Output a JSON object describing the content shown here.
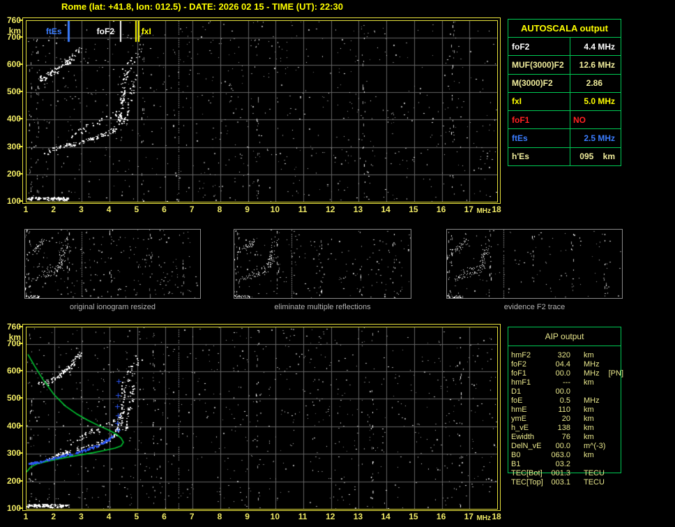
{
  "title": "Rome (lat: +41.8, lon: 012.5) - DATE: 2026 02 15 - TIME (UT): 22:30",
  "colors": {
    "background": "#000000",
    "frame_yellow": "#e8e23c",
    "tick_yellow": "#f0ea66",
    "title_yellow": "#ffff00",
    "grid_gray": "#666666",
    "table_green": "#00cc55",
    "white": "#ffffff",
    "khaki": "#f0ec9c",
    "yellow": "#ffff00",
    "red": "#ff2222",
    "blue": "#3b7dff",
    "aip_text": "#e9e78c",
    "caption_gray": "#b4b4b4",
    "profile_green": "#00c832",
    "trace_blue": "#2b55f0"
  },
  "autoscala_table": {
    "header": "AUTOSCALA output",
    "rows": [
      {
        "label": "foF2",
        "value": "4.4 MHz",
        "color": "white"
      },
      {
        "label": "MUF(3000)F2",
        "value": "12.6 MHz",
        "color": "khaki"
      },
      {
        "label": "M(3000)F2",
        "value": "2.86",
        "color": "khaki"
      },
      {
        "label": "fxI",
        "value": "5.0 MHz",
        "color": "yellow"
      },
      {
        "label": "foF1",
        "value": "NO",
        "color": "red"
      },
      {
        "label": "ftEs",
        "value": "2.5 MHz",
        "color": "blue"
      },
      {
        "label": "h'Es",
        "value": "095    km",
        "color": "khaki"
      }
    ]
  },
  "aip_table": {
    "header": "AIP output",
    "rows": [
      {
        "label": "hmF2",
        "value": "320",
        "unit": "km",
        "extra": ""
      },
      {
        "label": "foF2",
        "value": "04.4",
        "unit": "MHz",
        "extra": ""
      },
      {
        "label": "foF1",
        "value": "00.0",
        "unit": "MHz",
        "extra": "[PN]"
      },
      {
        "label": "hmF1",
        "value": "---",
        "unit": "km",
        "extra": ""
      },
      {
        "label": "D1",
        "value": "00.0",
        "unit": "",
        "extra": ""
      },
      {
        "label": "foE",
        "value": "0.5",
        "unit": "MHz",
        "extra": ""
      },
      {
        "label": "hmE",
        "value": "110",
        "unit": "km",
        "extra": ""
      },
      {
        "label": "ymE",
        "value": "20",
        "unit": "km",
        "extra": ""
      },
      {
        "label": "h_vE",
        "value": "138",
        "unit": "km",
        "extra": ""
      },
      {
        "label": "Ewidth",
        "value": "76",
        "unit": "km",
        "extra": ""
      },
      {
        "label": "DelN_vE",
        "value": "00.0",
        "unit": "m^(-3)",
        "extra": ""
      },
      {
        "label": "B0",
        "value": "063.0",
        "unit": "km",
        "extra": ""
      },
      {
        "label": "B1",
        "value": "03.2",
        "unit": "",
        "extra": ""
      },
      {
        "label": "TEC[Bot]",
        "value": "001.3",
        "unit": "TECU",
        "extra": ""
      },
      {
        "label": "TEC[Top]",
        "value": "003.1",
        "unit": "TECU",
        "extra": ""
      }
    ]
  },
  "thumbnails": [
    {
      "caption": "original ionogram resized",
      "noise_dots": 420
    },
    {
      "caption": "eliminate multiple reflections",
      "noise_dots": 330
    },
    {
      "caption": "evidence F2 trace",
      "noise_dots": 190
    }
  ],
  "chart_data": [
    {
      "type": "scatter",
      "name": "autoscaled ionogram",
      "xlabel": "MHz",
      "ylabel": "km",
      "xlim": [
        1,
        18
      ],
      "ylim": [
        100,
        760
      ],
      "x_ticks": [
        1,
        2,
        3,
        4,
        5,
        6,
        7,
        8,
        9,
        10,
        11,
        12,
        13,
        14,
        15,
        16,
        17,
        18
      ],
      "y_ticks": [
        760,
        700,
        600,
        500,
        400,
        300,
        200,
        100
      ],
      "grid": true,
      "markers": [
        {
          "label": "ftEs",
          "freq": 2.5,
          "color": "#3b7dff",
          "style": "line",
          "w": 3,
          "side": "left"
        },
        {
          "label": "foF2",
          "freq": 4.4,
          "color": "#ffffff",
          "style": "line",
          "w": 2,
          "side": "left"
        },
        {
          "label": "fxI",
          "freq": 5.0,
          "color": "#ffff00",
          "style": "double-line",
          "w": 2,
          "side": "right"
        }
      ],
      "traces": [
        {
          "name": "Es layer",
          "color": "#ffffff",
          "size": 2,
          "n": 100,
          "jitter": [
            2,
            2
          ],
          "points": [
            [
              1.05,
              112
            ],
            [
              2.5,
              110
            ]
          ]
        },
        {
          "name": "F2 ordinary",
          "color": "#ffffff",
          "size": 2,
          "n": 150,
          "jitter": [
            3,
            3
          ],
          "points": [
            [
              1.65,
              278
            ],
            [
              2.0,
              292
            ],
            [
              2.4,
              305
            ],
            [
              2.9,
              316
            ],
            [
              3.4,
              329
            ],
            [
              3.8,
              344
            ],
            [
              4.1,
              360
            ],
            [
              4.3,
              382
            ],
            [
              4.4,
              420
            ],
            [
              4.45,
              465
            ],
            [
              4.48,
              510
            ],
            [
              4.5,
              545
            ]
          ]
        },
        {
          "name": "F2 extraordinary",
          "color": "#ffffff",
          "size": 2,
          "n": 80,
          "jitter": [
            3,
            4
          ],
          "points": [
            [
              2.6,
              342
            ],
            [
              3.0,
              360
            ],
            [
              3.5,
              388
            ],
            [
              3.9,
              405
            ],
            [
              4.3,
              425
            ],
            [
              4.55,
              385
            ],
            [
              4.62,
              420
            ],
            [
              4.7,
              455
            ],
            [
              4.78,
              495
            ],
            [
              4.85,
              530
            ],
            [
              4.9,
              560
            ]
          ]
        },
        {
          "name": "F2 second hop",
          "color": "#ffffff",
          "size": 2,
          "n": 85,
          "jitter": [
            3,
            4
          ],
          "points": [
            [
              1.45,
              548
            ],
            [
              1.8,
              562
            ],
            [
              2.1,
              580
            ],
            [
              2.4,
              602
            ],
            [
              2.65,
              628
            ],
            [
              2.85,
              655
            ],
            [
              2.95,
              668
            ]
          ]
        },
        {
          "name": "spread near fxI",
          "color": "#ffffff",
          "size": 2,
          "n": 26,
          "jitter": [
            5,
            8
          ],
          "points": [
            [
              4.5,
              555
            ],
            [
              4.8,
              610
            ],
            [
              5.1,
              655
            ]
          ]
        }
      ],
      "noise": {
        "gray_n": 720,
        "white_n": 90,
        "columns": [
          1.15,
          1.4,
          5.2,
          9.35,
          13.2,
          16.4
        ],
        "vlines": [
          6.5
        ]
      }
    },
    {
      "type": "scatter",
      "name": "ionogram with restored trace and electron density profile",
      "xlabel": "MHz",
      "ylabel": "km",
      "xlim": [
        1,
        18
      ],
      "ylim": [
        100,
        760
      ],
      "x_ticks": [
        1,
        2,
        3,
        4,
        5,
        6,
        7,
        8,
        9,
        10,
        11,
        12,
        13,
        14,
        15,
        16,
        17,
        18
      ],
      "y_ticks": [
        760,
        700,
        600,
        500,
        400,
        300,
        200,
        100
      ],
      "grid": true,
      "markers": [],
      "traces": [
        {
          "name": "Es layer",
          "color": "#ffffff",
          "size": 2,
          "n": 110,
          "jitter": [
            2,
            2
          ],
          "points": [
            [
              1.05,
              112
            ],
            [
              2.5,
              110
            ]
          ]
        },
        {
          "name": "F2 ordinary",
          "color": "#ffffff",
          "size": 2,
          "n": 150,
          "jitter": [
            3,
            3
          ],
          "points": [
            [
              1.65,
              278
            ],
            [
              2.0,
              292
            ],
            [
              2.4,
              305
            ],
            [
              2.9,
              316
            ],
            [
              3.4,
              329
            ],
            [
              3.8,
              344
            ],
            [
              4.1,
              360
            ],
            [
              4.3,
              382
            ],
            [
              4.4,
              420
            ],
            [
              4.45,
              465
            ],
            [
              4.48,
              510
            ],
            [
              4.5,
              545
            ]
          ]
        },
        {
          "name": "F2 extraordinary",
          "color": "#ffffff",
          "size": 2,
          "n": 80,
          "jitter": [
            3,
            4
          ],
          "points": [
            [
              2.6,
              342
            ],
            [
              3.0,
              360
            ],
            [
              3.5,
              388
            ],
            [
              3.9,
              405
            ],
            [
              4.3,
              425
            ],
            [
              4.55,
              385
            ],
            [
              4.62,
              420
            ],
            [
              4.7,
              455
            ],
            [
              4.78,
              495
            ],
            [
              4.85,
              530
            ],
            [
              4.9,
              560
            ]
          ]
        },
        {
          "name": "F2 second hop",
          "color": "#ffffff",
          "size": 2,
          "n": 85,
          "jitter": [
            3,
            4
          ],
          "points": [
            [
              1.45,
              548
            ],
            [
              1.8,
              562
            ],
            [
              2.1,
              580
            ],
            [
              2.4,
              602
            ],
            [
              2.65,
              628
            ],
            [
              2.85,
              655
            ],
            [
              2.95,
              668
            ]
          ]
        },
        {
          "name": "spread near fxI",
          "color": "#ffffff",
          "size": 2,
          "n": 26,
          "jitter": [
            5,
            8
          ],
          "points": [
            [
              4.5,
              555
            ],
            [
              4.8,
              610
            ],
            [
              5.1,
              655
            ]
          ]
        }
      ],
      "noise": {
        "gray_n": 820,
        "white_n": 80,
        "columns": [
          1.15,
          5.6,
          9.35,
          13.5,
          16.7
        ],
        "vlines": [
          6.5
        ]
      },
      "profile": {
        "name": "electron density profile",
        "color": "#00c832",
        "points": [
          [
            1.05,
            662
          ],
          [
            1.3,
            618
          ],
          [
            1.6,
            570
          ],
          [
            2.0,
            515
          ],
          [
            2.4,
            474
          ],
          [
            2.8,
            446
          ],
          [
            3.2,
            423
          ],
          [
            3.6,
            403
          ],
          [
            4.0,
            385
          ],
          [
            4.25,
            371
          ],
          [
            4.42,
            357
          ],
          [
            4.5,
            342
          ],
          [
            4.42,
            329
          ],
          [
            4.2,
            321
          ],
          [
            3.8,
            312
          ],
          [
            3.4,
            304
          ],
          [
            3.0,
            297
          ],
          [
            2.6,
            290
          ],
          [
            2.2,
            282
          ],
          [
            1.8,
            274
          ],
          [
            1.4,
            264
          ],
          [
            1.15,
            252
          ],
          [
            1.0,
            234
          ]
        ]
      },
      "restored": {
        "name": "restored F2 trace",
        "color": "#2b55f0",
        "n": 170,
        "dense": [
          [
            1.05,
            262
          ],
          [
            1.5,
            272
          ],
          [
            2.0,
            284
          ],
          [
            2.5,
            297
          ],
          [
            3.0,
            310
          ],
          [
            3.4,
            324
          ],
          [
            3.8,
            342
          ],
          [
            4.0,
            355
          ],
          [
            4.15,
            368
          ]
        ],
        "marks": [
          [
            4.3,
            388
          ],
          [
            4.28,
            412
          ],
          [
            4.31,
            440
          ],
          [
            4.28,
            472
          ],
          [
            4.3,
            515
          ],
          [
            4.33,
            565
          ]
        ]
      }
    }
  ]
}
